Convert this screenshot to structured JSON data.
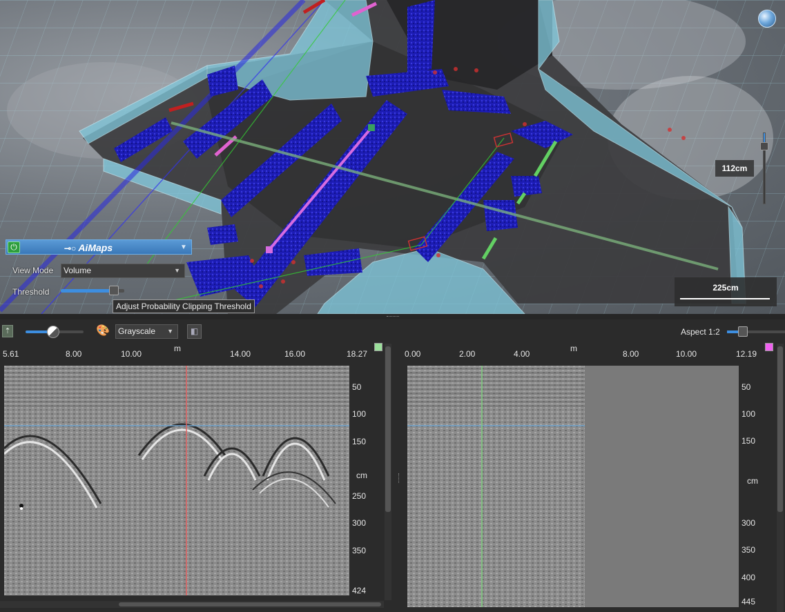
{
  "viewport": {
    "depth_label": "112cm",
    "scale_label": "225cm"
  },
  "aimaps": {
    "logo": "AiMaps",
    "view_mode_label": "View Mode",
    "view_mode_value": "Volume",
    "threshold_label": "Threshold",
    "threshold_level": 0.8,
    "tooltip": "Adjust Probability Clipping Threshold"
  },
  "toolbar": {
    "contrast_level": 0.5,
    "colormap_value": "Grayscale",
    "aspect_label": "Aspect 1:2",
    "aspect_level": 0.25
  },
  "left_radargram": {
    "x_unit": "m",
    "x_ticks": [
      "5.61",
      "8.00",
      "10.00",
      "14.00",
      "16.00",
      "18.27"
    ],
    "y_unit": "cm",
    "y_ticks": [
      "50",
      "100",
      "150",
      "250",
      "300",
      "350",
      "424"
    ],
    "marker_color": "#9be09b",
    "cursor_color": "#e06060"
  },
  "right_radargram": {
    "x_unit": "m",
    "x_ticks": [
      "0.00",
      "2.00",
      "4.00",
      "8.00",
      "10.00",
      "12.19"
    ],
    "y_unit": "cm",
    "y_ticks": [
      "50",
      "100",
      "150",
      "300",
      "350",
      "400",
      "445"
    ],
    "marker_color": "#f060f0",
    "cursor_color": "#7fd07f"
  },
  "colors": {
    "accent": "#3d8ee0",
    "pipe_blue": "#1a1aa8",
    "wall_cyan": "#7fc8dc"
  }
}
